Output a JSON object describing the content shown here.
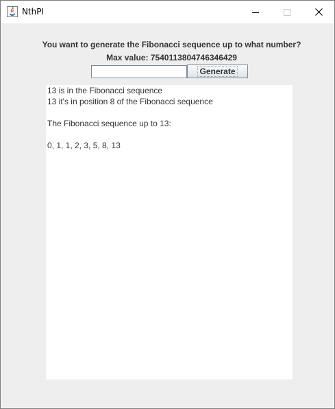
{
  "window": {
    "title": "NthPI",
    "icon": "java-icon",
    "controls": {
      "minimize": "minimize-icon",
      "maximize": "maximize-icon",
      "close": "close-icon"
    }
  },
  "form": {
    "question": "You want to generate the Fibonacci sequence up to what number?",
    "max_value": "Max value: 7540113804746346429",
    "input_value": "",
    "button_label": "Generate"
  },
  "output": {
    "lines": [
      "13 is in the Fibonacci sequence",
      "13 it's in position 8 of the Fibonacci sequence",
      "",
      "The Fibonacci sequence up to 13:",
      "",
      "0, 1, 1, 2, 3, 5, 8, 13"
    ]
  }
}
